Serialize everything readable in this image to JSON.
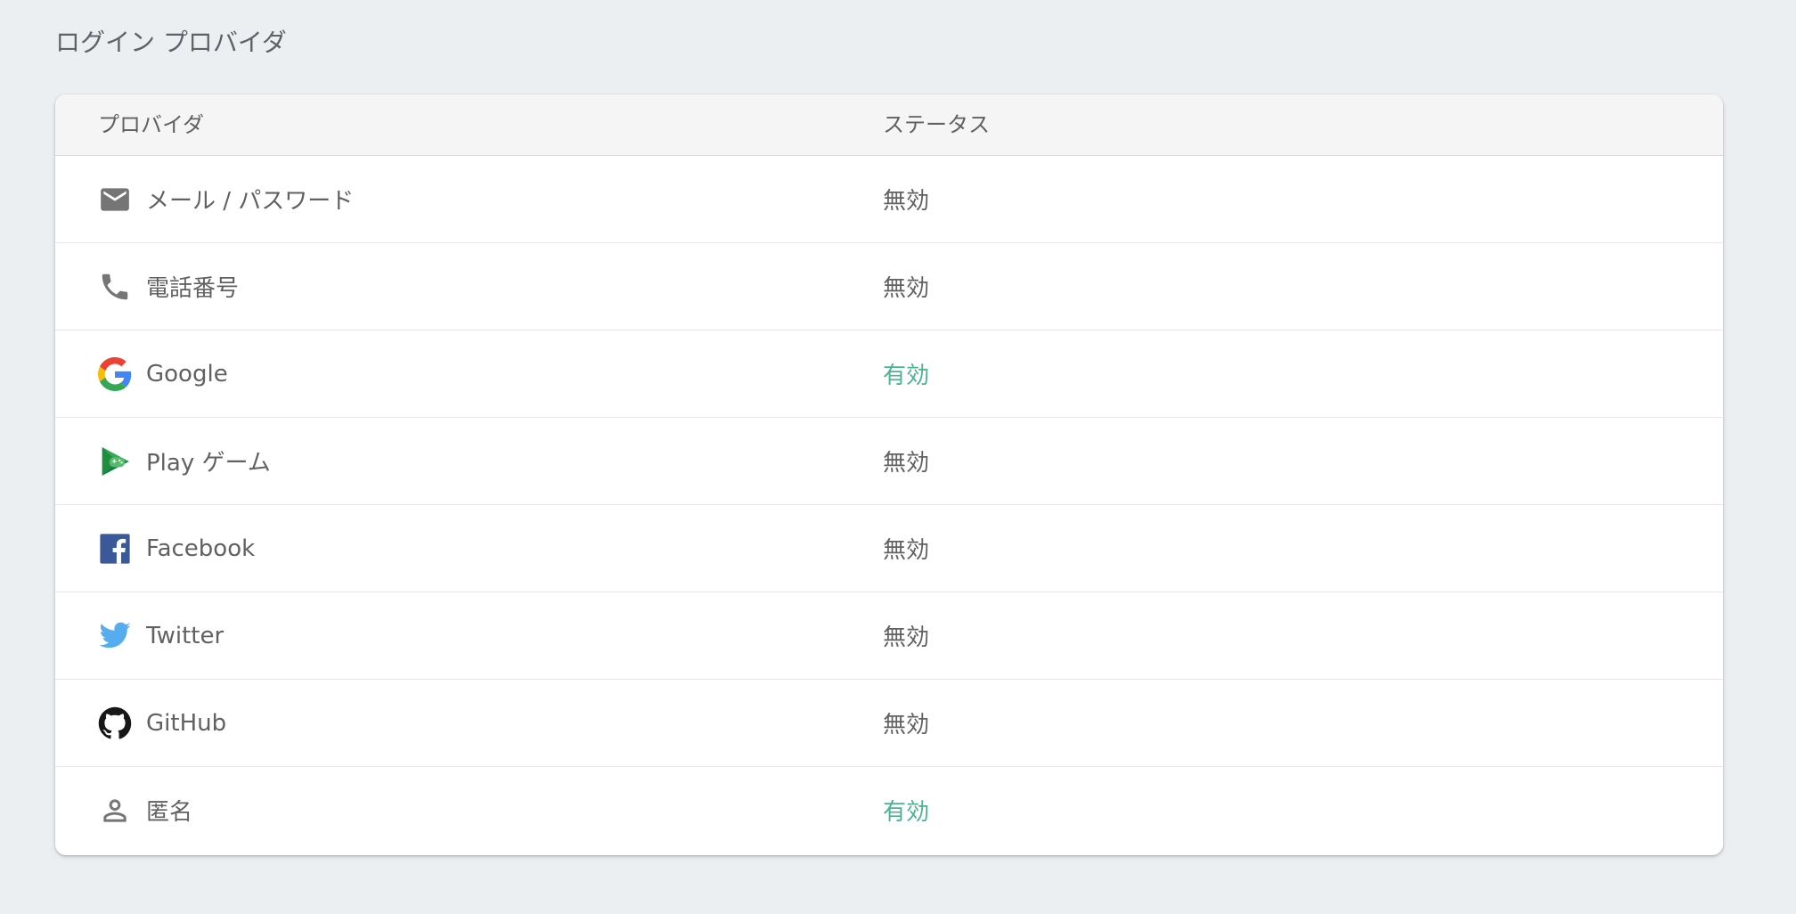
{
  "section_title": "ログイン プロバイダ",
  "table": {
    "headers": {
      "provider": "プロバイダ",
      "status": "ステータス"
    },
    "rows": [
      {
        "icon": "mail-icon",
        "provider": "メール / パスワード",
        "status": "無効",
        "enabled": false
      },
      {
        "icon": "phone-icon",
        "provider": "電話番号",
        "status": "無効",
        "enabled": false
      },
      {
        "icon": "google-icon",
        "provider": "Google",
        "status": "有効",
        "enabled": true
      },
      {
        "icon": "play-games-icon",
        "provider": "Play ゲーム",
        "status": "無効",
        "enabled": false
      },
      {
        "icon": "facebook-icon",
        "provider": "Facebook",
        "status": "無効",
        "enabled": false
      },
      {
        "icon": "twitter-icon",
        "provider": "Twitter",
        "status": "無効",
        "enabled": false
      },
      {
        "icon": "github-icon",
        "provider": "GitHub",
        "status": "無効",
        "enabled": false
      },
      {
        "icon": "person-icon",
        "provider": "匿名",
        "status": "有効",
        "enabled": true
      }
    ]
  },
  "colors": {
    "background": "#eceff1",
    "enabled_status": "#4cb38f",
    "text": "#616161",
    "facebook_blue": "#3b5998",
    "twitter_blue": "#55acee"
  }
}
